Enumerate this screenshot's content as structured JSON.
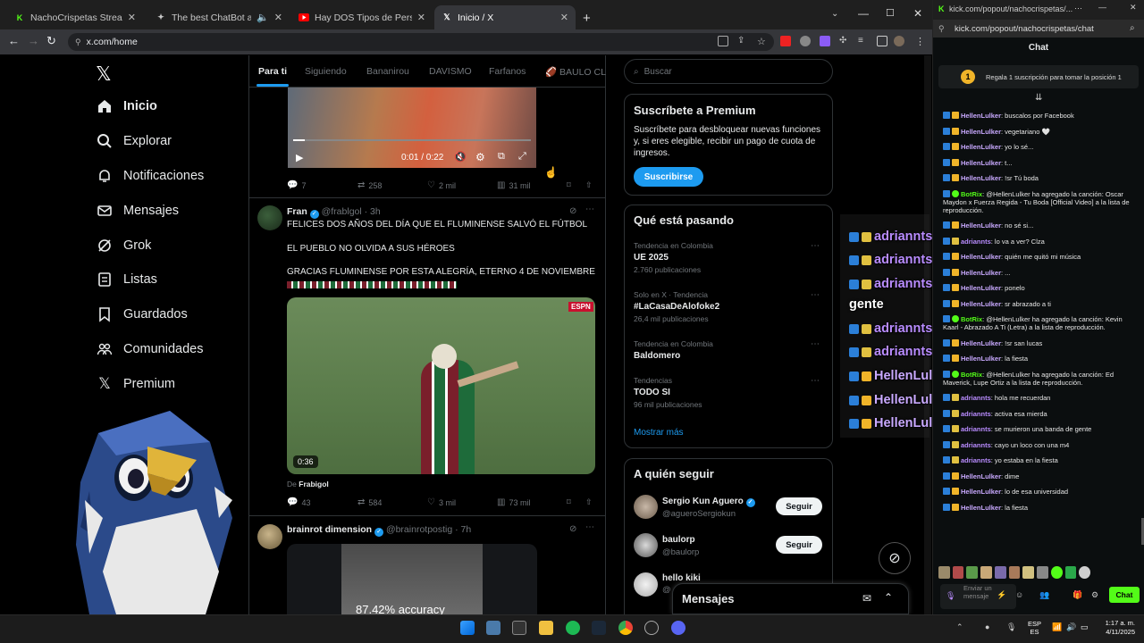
{
  "browser": {
    "tabs": [
      {
        "title": "NachoCrispetas Stream - Watch L",
        "icon": "kick-icon",
        "color": "#53fc18"
      },
      {
        "title": "The best ChatBot and Widgets",
        "icon": "botrix-icon",
        "color": "#ffffff"
      },
      {
        "title": "Hay DOS Tipos de Personas - ¿Cu",
        "icon": "youtube-icon",
        "color": "#ff0000"
      },
      {
        "title": "Inicio / X",
        "icon": "x-icon",
        "color": "#ffffff"
      }
    ],
    "url": "x.com/home",
    "window_controls": {
      "min": "—",
      "max": "☐",
      "close": "✕"
    }
  },
  "x": {
    "logo": "𝕏",
    "nav": [
      {
        "label": "Inicio",
        "icon": "home-icon",
        "glyph": "⌂"
      },
      {
        "label": "Explorar",
        "icon": "search-icon",
        "glyph": "⌕"
      },
      {
        "label": "Notificaciones",
        "icon": "bell-icon",
        "glyph": "🔔"
      },
      {
        "label": "Mensajes",
        "icon": "mail-icon",
        "glyph": "✉"
      },
      {
        "label": "Grok",
        "icon": "grok-icon",
        "glyph": "⊘"
      },
      {
        "label": "Listas",
        "icon": "list-icon",
        "glyph": "☰"
      },
      {
        "label": "Guardados",
        "icon": "bookmark-icon",
        "glyph": "⌑"
      },
      {
        "label": "Comunidades",
        "icon": "people-icon",
        "glyph": "👥"
      },
      {
        "label": "Premium",
        "icon": "x-premium-icon",
        "glyph": "𝕏"
      }
    ],
    "timeline_tabs": [
      "Para ti",
      "Siguiendo",
      "Bananirou",
      "DAVISMO",
      "Farfanos",
      "🏈 BAULO CLU"
    ],
    "post1": {
      "time": "0:01 / 0:22",
      "replies": "7",
      "reposts": "258",
      "likes": "2 mil",
      "views": "31 mil"
    },
    "post2": {
      "name": "Fran",
      "handle": "@frablgol",
      "age": "· 3h",
      "text1": "FELICES DOS AÑOS DEL DÍA QUE EL FLUMINENSE SALVÓ EL FÚTBOL",
      "text2": "EL PUEBLO NO OLVIDA A SUS HÉROES",
      "text3": "GRACIAS FLUMINENSE POR ESTA ALEGRÍA, ETERNO 4 DE NOVIEMBRE",
      "video_duration": "0:36",
      "video_badge": "ESPN",
      "from_prefix": "De",
      "from": "Frabigol",
      "replies": "43",
      "reposts": "584",
      "likes": "3 mil",
      "views": "73 mil"
    },
    "post3": {
      "name": "brainrot dimension",
      "handle": "@brainrotpostig",
      "age": "· 7h",
      "overlay_text": "87.42% accuracy"
    },
    "search_placeholder": "Buscar",
    "premium": {
      "title": "Suscríbete a Premium",
      "body": "Suscríbete para desbloquear nuevas funciones y, si eres elegible, recibir un pago de cuota de ingresos.",
      "button": "Suscribirse"
    },
    "trends": {
      "title": "Qué está pasando",
      "items": [
        {
          "cat": "Tendencia en Colombia",
          "name": "UE 2025",
          "count": "2.760 publicaciones"
        },
        {
          "cat": "Solo en X · Tendencia",
          "name": "#LaCasaDeAlofoke2",
          "count": "26,4 mil publicaciones"
        },
        {
          "cat": "Tendencia en Colombia",
          "name": "Baldomero",
          "count": ""
        },
        {
          "cat": "Tendencias",
          "name": "TODO SI",
          "count": "96 mil publicaciones"
        }
      ],
      "more": "Mostrar más"
    },
    "follow": {
      "title": "A quién seguir",
      "items": [
        {
          "name": "Sergio Kun Aguero",
          "handle": "@agueroSergiokun",
          "button": "Seguir"
        },
        {
          "name": "baulorp",
          "handle": "@baulorp",
          "button": "Seguir"
        },
        {
          "name": "hello kiki",
          "handle": "@",
          "button": "Seguir"
        }
      ]
    },
    "messages_bar": "Mensajes"
  },
  "overlay_chat": [
    {
      "user": "adriannts",
      "msg": ": hola me recuerdan"
    },
    {
      "user": "adriannts",
      "msg": ": activa esa mierda"
    },
    {
      "user": "adriannts",
      "msg": ": se murieron una banda de"
    },
    {
      "user": "",
      "msg": "gente"
    },
    {
      "user": "adriannts",
      "msg": ": cayo un loco con una m4"
    },
    {
      "user": "adriannts",
      "msg": ": yo estaba en la fiesta"
    },
    {
      "user": "HellenLulker",
      "msg": ": dime"
    },
    {
      "user": "HellenLulker",
      "msg": ": lo de esa universidad"
    },
    {
      "user": "HellenLulker",
      "msg": ": la fiesta"
    }
  ],
  "kick": {
    "url": "kick.com/popout/nachocrispetas/...",
    "url_full": "kick.com/popout/nachocrispetas/chat",
    "header": "Chat",
    "pinned_rank": "1",
    "pinned": "Regala 1 suscripción para tomar la posición 1",
    "messages": [
      {
        "user": "HellenLulker",
        "msg": ": buscalos por Facebook"
      },
      {
        "user": "HellenLulker",
        "msg": ": vegetariano 🤍"
      },
      {
        "user": "HellenLulker",
        "msg": ": yo lo sé..."
      },
      {
        "user": "HellenLulker",
        "msg": ": t..."
      },
      {
        "user": "HellenLulker",
        "msg": ": !sr Tú boda"
      },
      {
        "user": "BotRix",
        "msg": ": @HellenLulker ha agregado la canción: Oscar Maydon x Fuerza Regida - Tu Boda [Official Video] a la lista de reproducción."
      },
      {
        "user": "HellenLulker",
        "msg": ": no sé si..."
      },
      {
        "user": "adriannts",
        "msg": ": lo va a ver? Clza"
      },
      {
        "user": "HellenLulker",
        "msg": ": quién me quitó mi música"
      },
      {
        "user": "HellenLulker",
        "msg": ": ..."
      },
      {
        "user": "HellenLulker",
        "msg": ": ponelo"
      },
      {
        "user": "HellenLulker",
        "msg": ": sr abrazado a ti"
      },
      {
        "user": "BotRix",
        "msg": ": @HellenLulker ha agregado la canción: Kevin Kaarl - Abrazado A Ti (Letra) a la lista de reproducción."
      },
      {
        "user": "HellenLulker",
        "msg": ": !sr san lucas"
      },
      {
        "user": "HellenLulker",
        "msg": ": la fiesta"
      },
      {
        "user": "BotRix",
        "msg": ": @HellenLulker ha agregado la canción: Ed Maverick, Lupe Ortiz a la lista de reproducción."
      },
      {
        "user": "adriannts",
        "msg": ": hola me recuerdan"
      },
      {
        "user": "adriannts",
        "msg": ": activa esa mierda"
      },
      {
        "user": "adriannts",
        "msg": ": se murieron una banda de gente"
      },
      {
        "user": "adriannts",
        "msg": ": cayo un loco con una m4"
      },
      {
        "user": "adriannts",
        "msg": ": yo estaba en la fiesta"
      },
      {
        "user": "HellenLulker",
        "msg": ": dime"
      },
      {
        "user": "HellenLulker",
        "msg": ": lo de esa universidad"
      },
      {
        "user": "HellenLulker",
        "msg": ": la fiesta"
      }
    ],
    "input_placeholder": "Enviar un mensaje",
    "send": "Chat"
  },
  "taskbar": {
    "lang1": "ESP",
    "lang2": "ES",
    "time": "1:17 a. m.",
    "date": "4/11/2025"
  },
  "colors": {
    "x_blue": "#1d9bf0",
    "kick_green": "#53fc18",
    "overlay_purple": "#b98cff",
    "hellen_purple": "#c9a9ff"
  }
}
